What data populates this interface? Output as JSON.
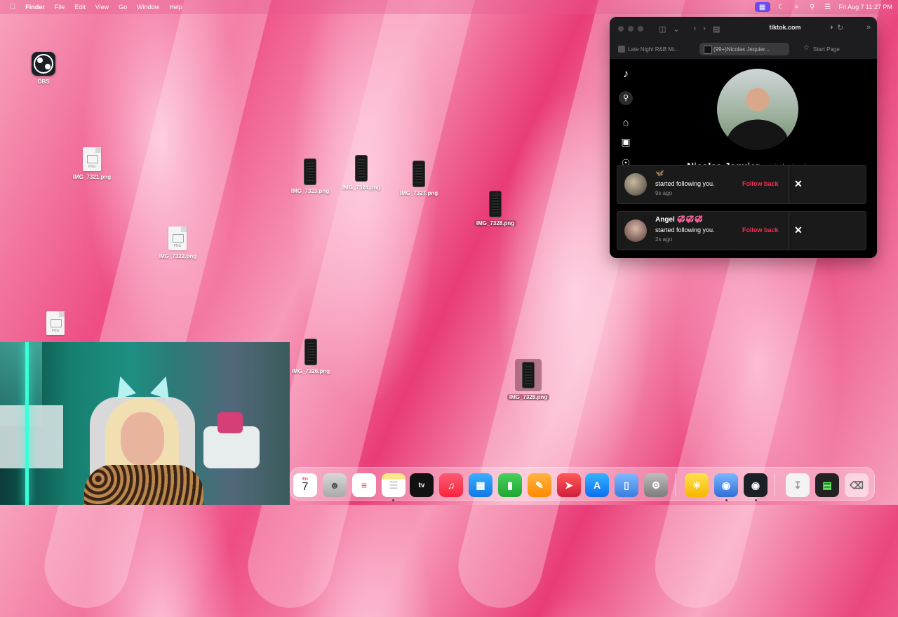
{
  "menubar": {
    "app": "Finder",
    "items": [
      "File",
      "Edit",
      "View",
      "Go",
      "Window",
      "Help"
    ],
    "clock": "Fri Aug 7  11:27 PM"
  },
  "desktop": {
    "obs_label": "OBS",
    "files": {
      "img_7321": "IMG_7321.png",
      "img_7322": "IMG_7322.png",
      "img_7323": "IMG_7323.png",
      "img_7324": "IMG_7324.png",
      "img_7327": "IMG_7327.png",
      "img_7328_a": "IMG_7328.png",
      "img_7326": "IMG_7326.png",
      "img_7328_b": "IMG_7328.png"
    },
    "doc_tag": "PNG"
  },
  "browser": {
    "url": "tiktok.com",
    "tabs": [
      {
        "label": "Late Night R&B Mi..."
      },
      {
        "label": "(99+)Nicolas Jequier..."
      },
      {
        "label": "Start Page"
      }
    ],
    "profile": {
      "name": "Nicolas Jequier",
      "handle": "nicolas.jequier"
    },
    "notifications": [
      {
        "name": "🦋",
        "text": "started following you.",
        "time": "9s ago",
        "action": "Follow back"
      },
      {
        "name": "Angel 💞💞💞",
        "text": "started following you.",
        "time": "2s ago",
        "action": "Follow back"
      }
    ]
  },
  "dock": {
    "calendar_day": "Fri",
    "calendar_date": "7",
    "tv_label": "tv"
  }
}
